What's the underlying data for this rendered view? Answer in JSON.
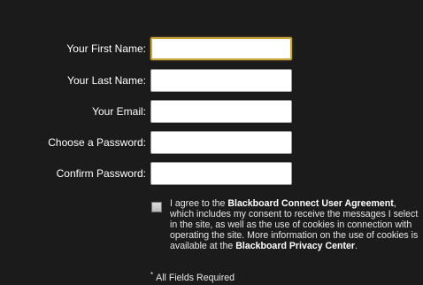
{
  "form": {
    "first_name": {
      "label": "Your First Name:",
      "value": "",
      "placeholder": ""
    },
    "last_name": {
      "label": "Your Last Name:",
      "value": "",
      "placeholder": ""
    },
    "email": {
      "label": "Your Email:",
      "value": "",
      "placeholder": ""
    },
    "password": {
      "label": "Choose a Password:",
      "value": "",
      "placeholder": ""
    },
    "confirm_password": {
      "label": "Confirm Password:",
      "value": "",
      "placeholder": ""
    }
  },
  "agreement": {
    "checked": false,
    "text_1": "I agree to the ",
    "link_1": "Blackboard Connect User Agreement",
    "text_2": ", which includes my consent to receive the messages I select in the site, as well as the use of cookies in connection with operating the site. More information on the use of cookies is available at the ",
    "link_2": "Blackboard Privacy Center",
    "text_3": "."
  },
  "footer": {
    "required_mark": "*",
    "required_text": "All Fields Required"
  },
  "colors": {
    "panel_background": "#1b1b1b",
    "focus_border": "#c9a640",
    "label_text": "#ffffff"
  }
}
